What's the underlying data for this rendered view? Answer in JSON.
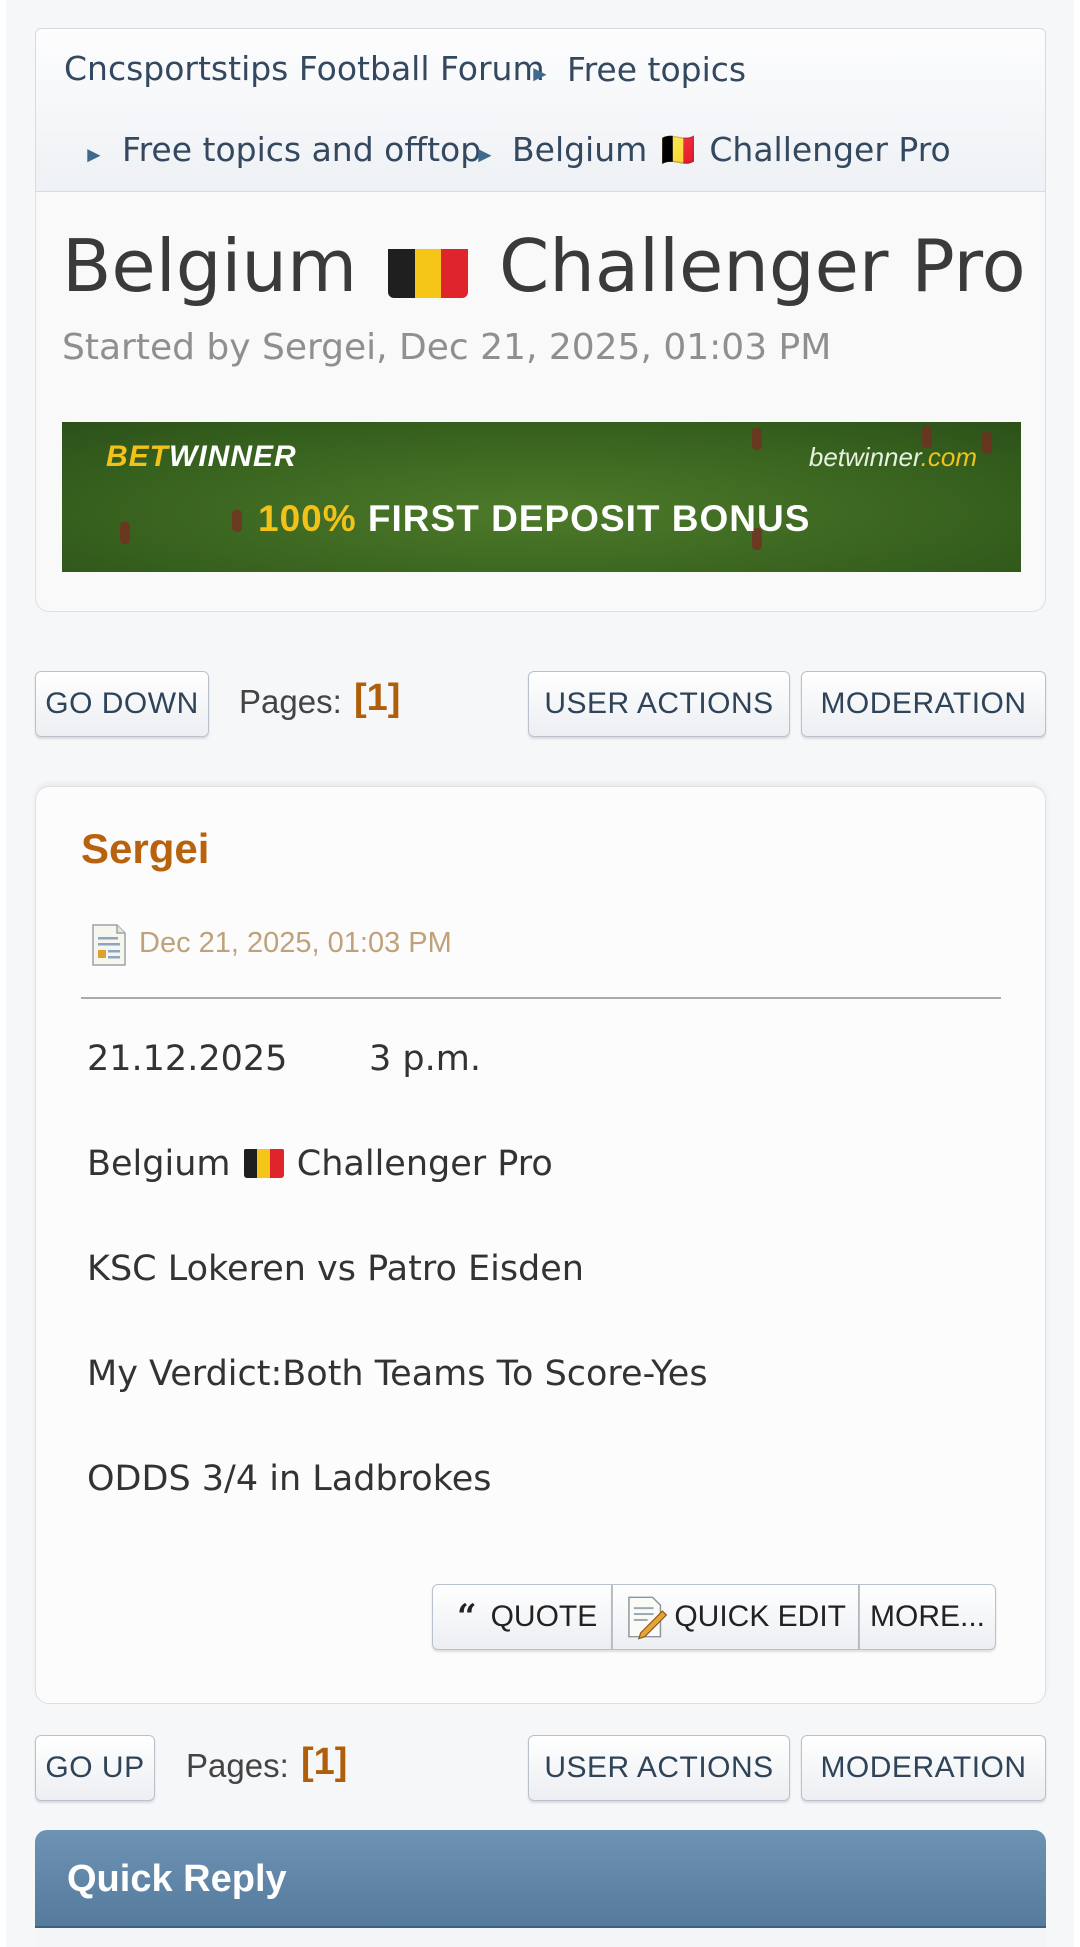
{
  "breadcrumb": {
    "items": [
      "Cncsportstips Football Forum",
      "Free topics",
      "Free topics and offtop",
      "Belgium 🇧🇪 Challenger Pro"
    ]
  },
  "topic": {
    "title_prefix": "Belgium",
    "title_suffix": "Challenger Pro",
    "started_by": "Started by Sergei, Dec 21, 2025, 01:03 PM"
  },
  "banner": {
    "brand_part1": "BET",
    "brand_part2": "WINNER",
    "site_part1": "betwinner",
    "site_part2": ".com",
    "promo_pct": "100%",
    "promo_text": "FIRST DEPOSIT BONUS"
  },
  "nav_top": {
    "go_down": "GO DOWN",
    "pages_label": "Pages:",
    "pages_value": "[1]",
    "user_actions": "USER ACTIONS",
    "moderation": "MODERATION"
  },
  "post": {
    "author": "Sergei",
    "date": "Dec 21, 2025, 01:03 PM",
    "date_line": "21.12.2025",
    "time_line": "3 p.m.",
    "league_prefix": "Belgium",
    "league_suffix": "Challenger Pro",
    "match": "KSC Lokeren vs Patro Eisden",
    "verdict": "My Verdict:Both Teams To Score-Yes",
    "odds": "ODDS 3/4 in Ladbrokes",
    "actions": {
      "quote": "QUOTE",
      "quick_edit": "QUICK EDIT",
      "more": "MORE..."
    }
  },
  "nav_bottom": {
    "go_up": "GO UP",
    "pages_label": "Pages:",
    "pages_value": "[1]",
    "user_actions": "USER ACTIONS",
    "moderation": "MODERATION"
  },
  "quick_reply": {
    "title": "Quick Reply"
  },
  "colors": {
    "accent_orange": "#b05e0a",
    "header_blue": "#5b81a3",
    "belgium_black": "#1f1f1f",
    "belgium_yellow": "#f5c518",
    "belgium_red": "#e0242b"
  }
}
